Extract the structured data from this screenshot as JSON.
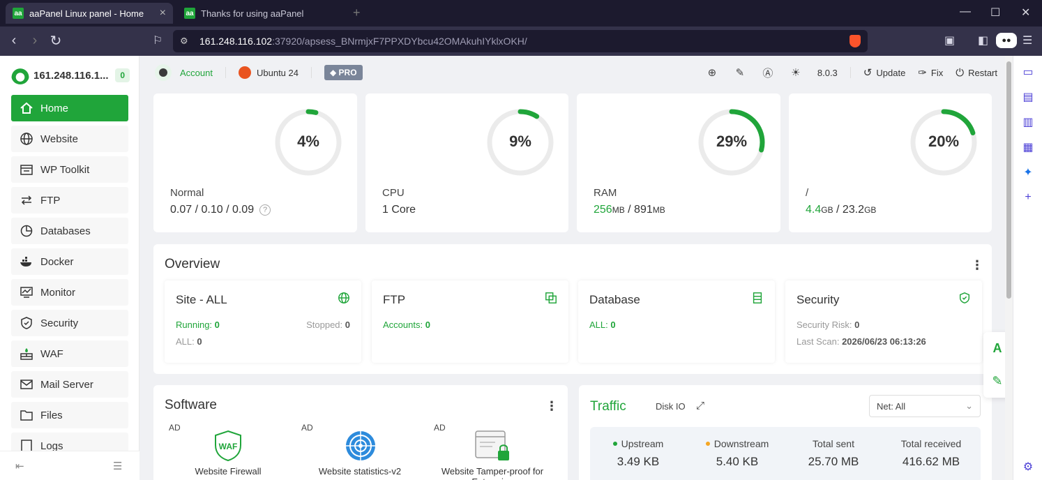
{
  "browser": {
    "tabs": [
      {
        "label": "aaPanel Linux panel - Home",
        "favicon": "aa"
      },
      {
        "label": "Thanks for using aaPanel",
        "favicon": "aa"
      }
    ],
    "url_host": "161.248.116.102",
    "url_path": ":37920/apsess_BNrmjxF7PPXDYbcu42OMAkuhIYklxOKH/"
  },
  "sidebar": {
    "server_ip": "161.248.116.1...",
    "badge": "0",
    "items": [
      {
        "label": "Home",
        "icon": "home-icon"
      },
      {
        "label": "Website",
        "icon": "globe-icon"
      },
      {
        "label": "WP Toolkit",
        "icon": "toolkit-icon"
      },
      {
        "label": "FTP",
        "icon": "transfer-icon"
      },
      {
        "label": "Databases",
        "icon": "database-icon"
      },
      {
        "label": "Docker",
        "icon": "docker-icon"
      },
      {
        "label": "Monitor",
        "icon": "monitor-icon"
      },
      {
        "label": "Security",
        "icon": "shield-icon"
      },
      {
        "label": "WAF",
        "icon": "firewall-icon"
      },
      {
        "label": "Mail Server",
        "icon": "mail-icon"
      },
      {
        "label": "Files",
        "icon": "folder-icon"
      },
      {
        "label": "Logs",
        "icon": "log-icon"
      }
    ]
  },
  "header": {
    "account": "Account",
    "os": "Ubuntu 24",
    "pro": "PRO",
    "version": "8.0.3",
    "update": "Update",
    "fix": "Fix",
    "restart": "Restart"
  },
  "metrics": [
    {
      "percent": 4,
      "percent_text": "4%",
      "label": "Normal",
      "value": "0.07 / 0.10 / 0.09"
    },
    {
      "percent": 9,
      "percent_text": "9%",
      "label": "CPU",
      "value": "1 Core"
    },
    {
      "percent": 29,
      "percent_text": "29%",
      "label": "RAM",
      "used": "256",
      "used_unit": "MB",
      "total": " / 891",
      "total_unit": "MB"
    },
    {
      "percent": 20,
      "percent_text": "20%",
      "label": "/",
      "used": "4.4",
      "used_unit": "GB",
      "total": " / 23.2",
      "total_unit": "GB"
    }
  ],
  "overview": {
    "title": "Overview",
    "site": {
      "title": "Site - ALL",
      "running_label": "Running:",
      "running": "0",
      "stopped_label": "Stopped:",
      "stopped": "0",
      "all_label": "ALL:",
      "all": "0"
    },
    "ftp": {
      "title": "FTP",
      "accounts_label": "Accounts:",
      "accounts": "0"
    },
    "database": {
      "title": "Database",
      "all_label": "ALL:",
      "all": "0"
    },
    "security": {
      "title": "Security",
      "risk_label": "Security Risk:",
      "risk": "0",
      "scan_label": "Last Scan:",
      "scan": "2026/06/23 06:13:26"
    }
  },
  "software": {
    "title": "Software",
    "items": [
      {
        "ad": "AD",
        "name": "Website Firewall"
      },
      {
        "ad": "AD",
        "name": "Website statistics-v2"
      },
      {
        "ad": "AD",
        "name": "Website Tamper-proof for Enterprise"
      }
    ]
  },
  "traffic": {
    "title": "Traffic",
    "disk_io": "Disk IO",
    "net_select": "Net: All",
    "upstream_label": "Upstream",
    "upstream": "3.49 KB",
    "downstream_label": "Downstream",
    "downstream": "5.40 KB",
    "sent_label": "Total sent",
    "sent": "25.70 MB",
    "received_label": "Total received",
    "received": "416.62 MB"
  },
  "colors": {
    "accent": "#20a53a",
    "track": "#ebebeb",
    "upstream": "#20a53a",
    "downstream": "#f5a623"
  }
}
